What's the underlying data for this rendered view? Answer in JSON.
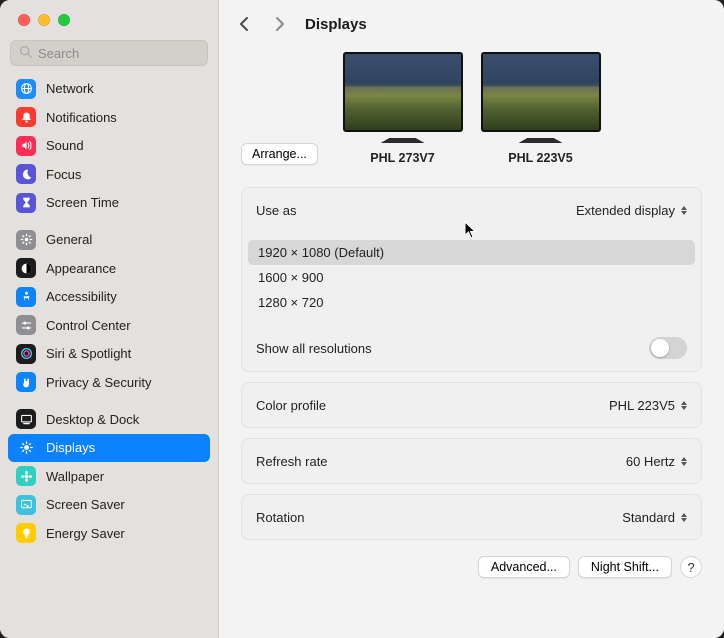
{
  "search": {
    "placeholder": "Search"
  },
  "sidebar": {
    "groups": [
      [
        {
          "label": "Network",
          "bg": "#1e8cff",
          "icon": "globe"
        },
        {
          "label": "Notifications",
          "bg": "#ff3b30",
          "icon": "bell"
        },
        {
          "label": "Sound",
          "bg": "#ff2d55",
          "icon": "speaker"
        },
        {
          "label": "Focus",
          "bg": "#5856d6",
          "icon": "moon"
        },
        {
          "label": "Screen Time",
          "bg": "#5856d6",
          "icon": "hourglass"
        }
      ],
      [
        {
          "label": "General",
          "bg": "#8e8e93",
          "icon": "gear"
        },
        {
          "label": "Appearance",
          "bg": "#1c1c1e",
          "icon": "appearance"
        },
        {
          "label": "Accessibility",
          "bg": "#0a84ff",
          "icon": "access"
        },
        {
          "label": "Control Center",
          "bg": "#8e8e93",
          "icon": "sliders"
        },
        {
          "label": "Siri & Spotlight",
          "bg": "#1c1c1e",
          "icon": "siri"
        },
        {
          "label": "Privacy & Security",
          "bg": "#0a84ff",
          "icon": "hand"
        }
      ],
      [
        {
          "label": "Desktop & Dock",
          "bg": "#1c1c1e",
          "icon": "dock"
        },
        {
          "label": "Displays",
          "bg": "#0a84ff",
          "icon": "sun",
          "active": true
        },
        {
          "label": "Wallpaper",
          "bg": "#30d0c0",
          "icon": "flower"
        },
        {
          "label": "Screen Saver",
          "bg": "#40c0dd",
          "icon": "screensaver"
        },
        {
          "label": "Energy Saver",
          "bg": "#ffcc00",
          "icon": "bulb"
        }
      ]
    ]
  },
  "header": {
    "title": "Displays"
  },
  "arrange_label": "Arrange...",
  "displays": [
    {
      "label": "PHL 273V7"
    },
    {
      "label": "PHL 223V5",
      "selected": true
    }
  ],
  "use_as": {
    "label": "Use as",
    "value": "Extended display"
  },
  "resolutions": [
    {
      "label": "1920 × 1080 (Default)",
      "selected": true
    },
    {
      "label": "1600 × 900"
    },
    {
      "label": "1280 × 720"
    }
  ],
  "show_all": {
    "label": "Show all resolutions",
    "on": false
  },
  "color_profile": {
    "label": "Color profile",
    "value": "PHL 223V5"
  },
  "refresh_rate": {
    "label": "Refresh rate",
    "value": "60 Hertz"
  },
  "rotation": {
    "label": "Rotation",
    "value": "Standard"
  },
  "buttons": {
    "advanced": "Advanced...",
    "night_shift": "Night Shift...",
    "help": "?"
  }
}
